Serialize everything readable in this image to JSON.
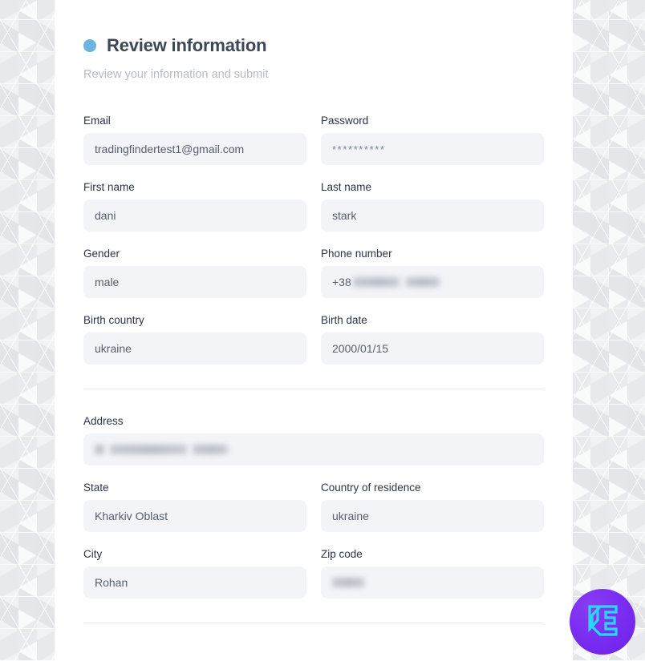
{
  "section": {
    "title": "Review information",
    "subtitle": "Review your information and submit",
    "bullet_color": "#6ab4dd"
  },
  "fields": [
    {
      "label": "Email",
      "value": "tradingfindertest1@gmail.com",
      "redacted": false,
      "full": false
    },
    {
      "label": "Password",
      "value": "**********",
      "redacted": false,
      "full": false,
      "masked": true
    },
    {
      "label": "First name",
      "value": "dani",
      "redacted": false,
      "full": false
    },
    {
      "label": "Last name",
      "value": "stark",
      "redacted": false,
      "full": false
    },
    {
      "label": "Gender",
      "value": "male",
      "redacted": false,
      "full": false
    },
    {
      "label": "Phone number",
      "value": "+38",
      "redacted": true,
      "full": false
    },
    {
      "label": "Birth country",
      "value": "ukraine",
      "redacted": false,
      "full": false
    },
    {
      "label": "Birth date",
      "value": "2000/01/15",
      "redacted": false,
      "full": false
    },
    {
      "label": "Address",
      "value": "",
      "redacted": true,
      "full": true
    },
    {
      "label": "State",
      "value": "Kharkiv Oblast",
      "redacted": false,
      "full": false
    },
    {
      "label": "Country of residence",
      "value": "ukraine",
      "redacted": false,
      "full": false
    },
    {
      "label": "City",
      "value": "Rohan",
      "redacted": false,
      "full": false
    },
    {
      "label": "Zip code",
      "value": "",
      "redacted": true,
      "full": false
    }
  ],
  "widget": {
    "icon": "chat-widget-logo-icon",
    "background_color": "#7b2ff2",
    "logo_color": "#27d8f5"
  }
}
